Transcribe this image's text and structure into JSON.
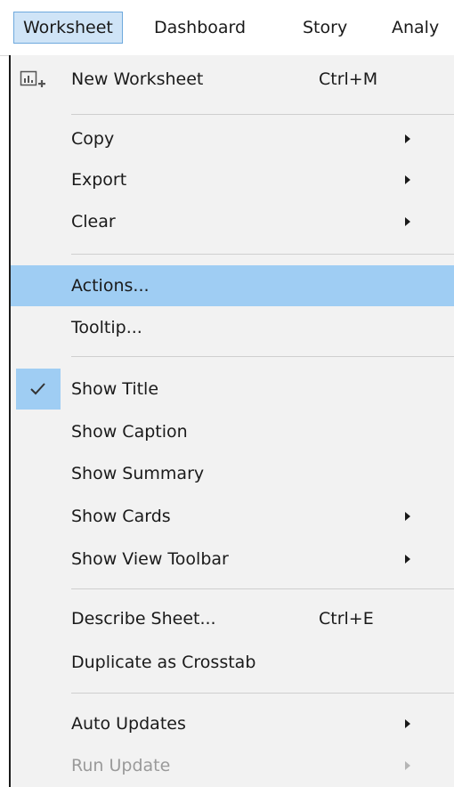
{
  "menubar": {
    "items": [
      {
        "label": "Worksheet"
      },
      {
        "label": "Dashboard"
      },
      {
        "label": "Story"
      },
      {
        "label": "Analy"
      }
    ]
  },
  "menu": {
    "new_worksheet": {
      "label": "New Worksheet",
      "shortcut": "Ctrl+M",
      "icon": "new-worksheet-icon"
    },
    "copy": {
      "label": "Copy"
    },
    "export": {
      "label": "Export"
    },
    "clear": {
      "label": "Clear"
    },
    "actions": {
      "label": "Actions..."
    },
    "tooltip": {
      "label": "Tooltip..."
    },
    "show_title": {
      "label": "Show Title",
      "checked": true
    },
    "show_caption": {
      "label": "Show Caption"
    },
    "show_summary": {
      "label": "Show Summary"
    },
    "show_cards": {
      "label": "Show Cards"
    },
    "show_view_toolbar": {
      "label": "Show View Toolbar"
    },
    "describe_sheet": {
      "label": "Describe Sheet...",
      "shortcut": "Ctrl+E"
    },
    "duplicate_as_crosstab": {
      "label": "Duplicate as Crosstab"
    },
    "auto_updates": {
      "label": "Auto Updates"
    },
    "run_update": {
      "label": "Run Update",
      "disabled": true
    }
  },
  "colors": {
    "highlight": "#9fcdf3",
    "menubar_active": "#cfe4f7",
    "menubar_active_border": "#6ea9dd",
    "menu_background": "#f2f2f2"
  }
}
